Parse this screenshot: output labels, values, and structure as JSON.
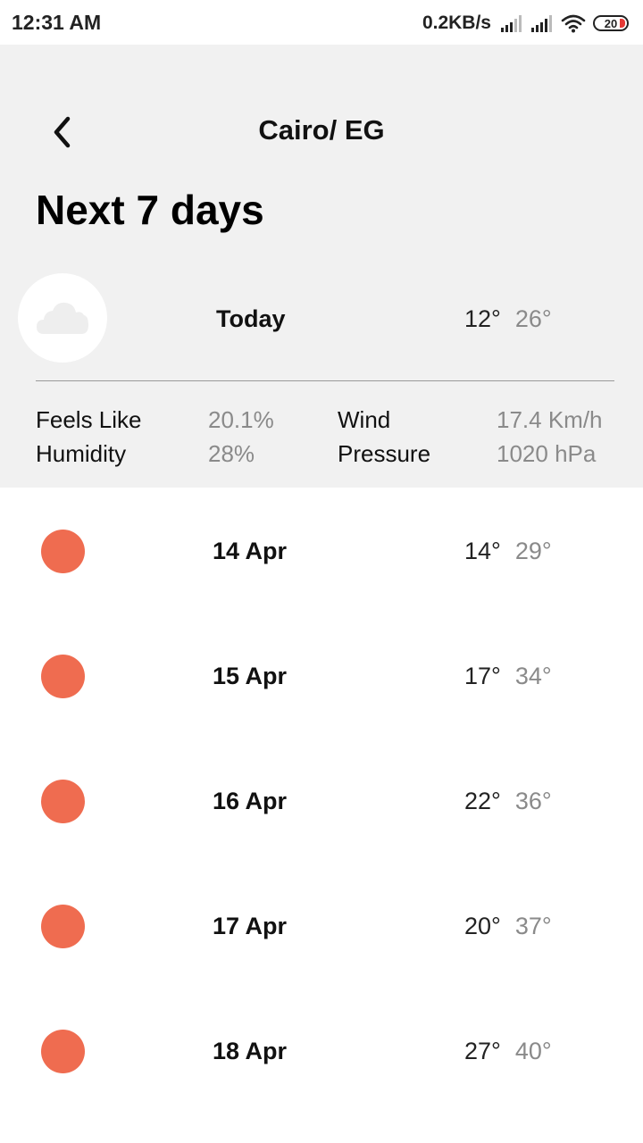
{
  "status_bar": {
    "time": "12:31 AM",
    "net_speed": "0.2KB/s",
    "battery": "20"
  },
  "header": {
    "city": "Cairo/ EG",
    "back_icon": "chevron-left-icon"
  },
  "section_title": "Next 7 days",
  "today": {
    "icon": "cloud-icon",
    "label": "Today",
    "min": "12°",
    "max": "26°",
    "details": {
      "feels_like_label": "Feels Like",
      "feels_like_value": "20.1%",
      "humidity_label": "Humidity",
      "humidity_value": "28%",
      "wind_label": "Wind",
      "wind_value": "17.4 Km/h",
      "pressure_label": "Pressure",
      "pressure_value": "1020 hPa"
    }
  },
  "forecast": [
    {
      "date": "14 Apr",
      "min": "14°",
      "max": "29°",
      "icon": "sun-icon"
    },
    {
      "date": "15 Apr",
      "min": "17°",
      "max": "34°",
      "icon": "sun-icon"
    },
    {
      "date": "16 Apr",
      "min": "22°",
      "max": "36°",
      "icon": "sun-icon"
    },
    {
      "date": "17 Apr",
      "min": "20°",
      "max": "37°",
      "icon": "sun-icon"
    },
    {
      "date": "18 Apr",
      "min": "27°",
      "max": "40°",
      "icon": "sun-icon"
    }
  ],
  "colors": {
    "header_bg": "#f1f1f1",
    "sun": "#ef6c50",
    "muted_text": "#8a8a8a"
  }
}
